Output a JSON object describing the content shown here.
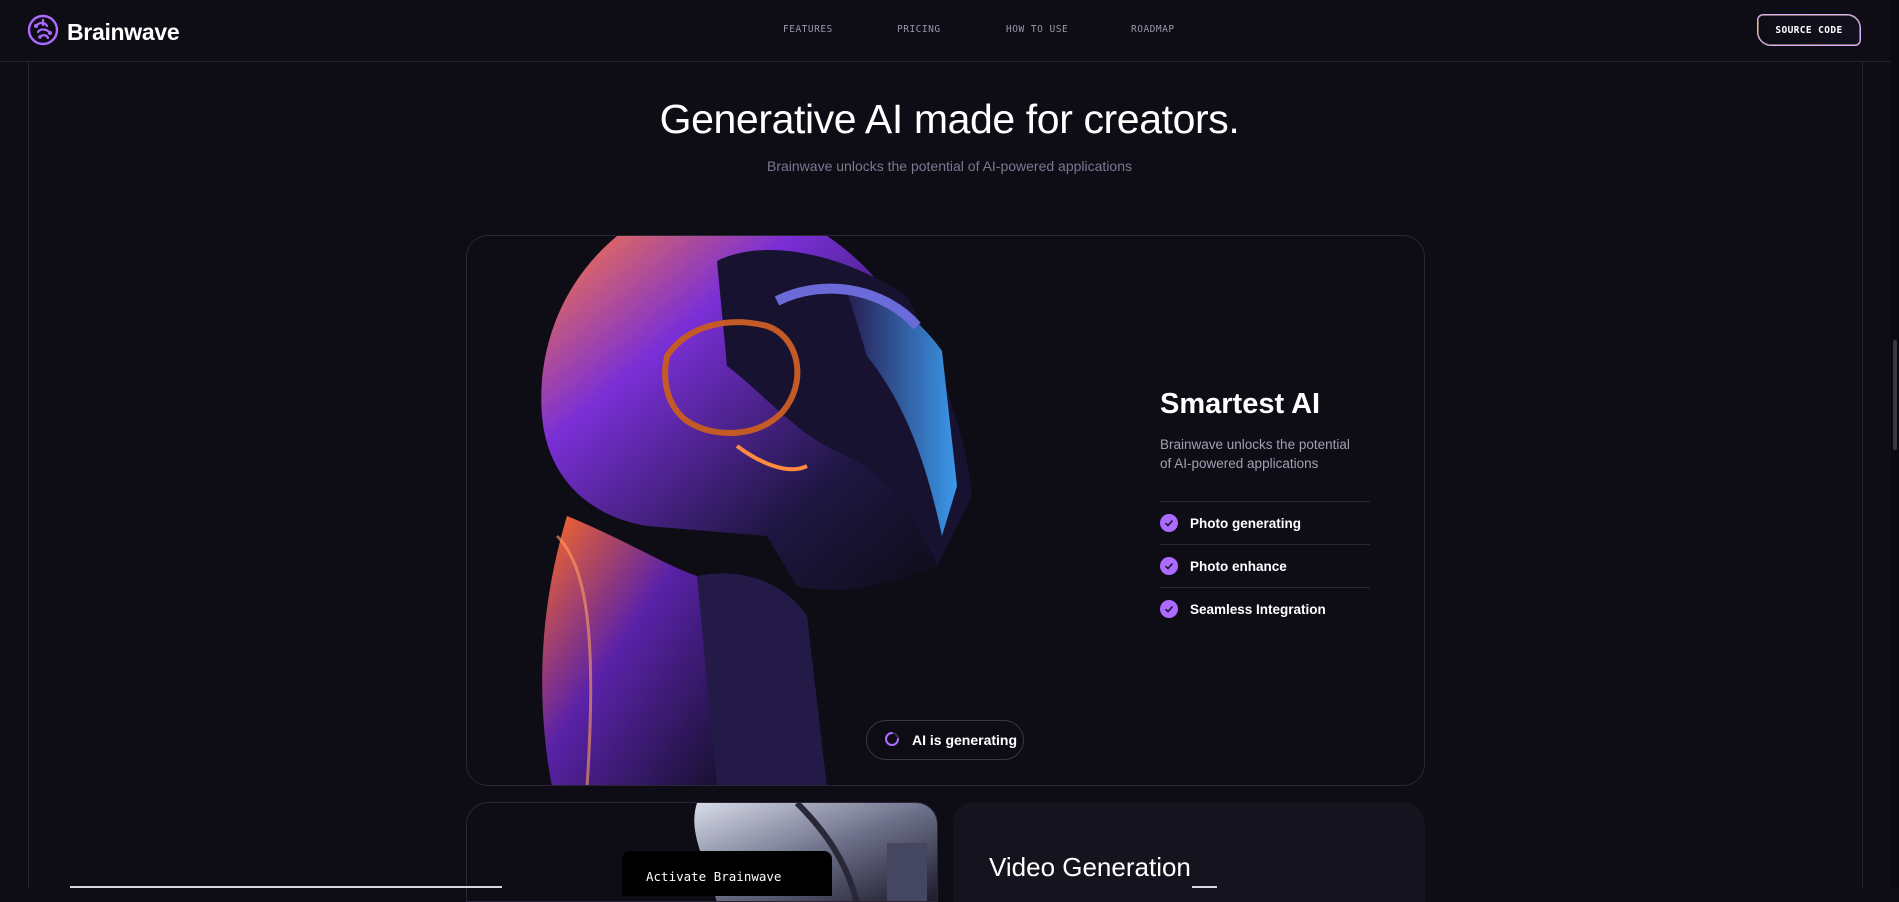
{
  "header": {
    "brand": "Brainwave",
    "nav": [
      "FEATURES",
      "PRICING",
      "HOW TO USE",
      "ROADMAP"
    ],
    "source_button": "SOURCE CODE"
  },
  "hero": {
    "title": "Generative AI made for creators.",
    "subtitle": "Brainwave unlocks the potential of AI-powered applications"
  },
  "feature_card": {
    "title": "Smartest AI",
    "description": "Brainwave unlocks the potential of AI-powered applications",
    "items": [
      "Photo generating",
      "Photo enhance",
      "Seamless Integration"
    ],
    "status": "AI is generating"
  },
  "lower_cards": {
    "terminal_text": "Activate Brainwave",
    "video_title": "Video Generation"
  },
  "colors": {
    "background": "#0e0c15",
    "accent": "#ac6aff",
    "stroke": "#252134"
  }
}
